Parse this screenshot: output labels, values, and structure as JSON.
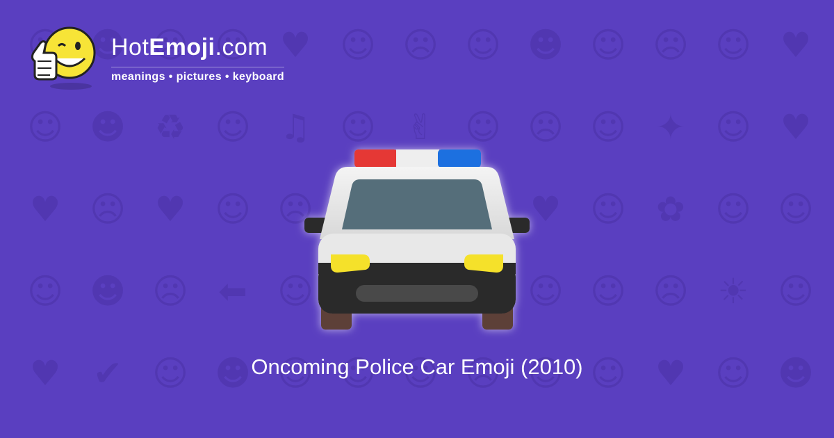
{
  "site": {
    "brand_prefix": "Hot",
    "brand_bold": "Emoji",
    "brand_suffix": ".com",
    "tagline": "meanings • pictures • keyboard",
    "mascot_icon": "winking-thumbs-up-face-icon"
  },
  "emoji": {
    "icon": "oncoming-police-car-icon",
    "caption": "Oncoming Police Car Emoji (2010)"
  },
  "background_icons": [
    "☺",
    "☻",
    "☹",
    "☺",
    "♥",
    "☺",
    "☹",
    "☺",
    "☻",
    "☺",
    "☹",
    "☺",
    "♥",
    "☺",
    "☻",
    "♻",
    "☺",
    "♫",
    "☺",
    "✌",
    "☺",
    "☹",
    "☺",
    "✦",
    "☺",
    "♥",
    "♥",
    "☹",
    "♥",
    "☺",
    "☹",
    "☺",
    "☺",
    "☻",
    "♥",
    "☺",
    "✿",
    "☺",
    "☺",
    "☺",
    "☻",
    "☹",
    "⬅",
    "☺",
    "☺",
    "☻",
    "☺",
    "☺",
    "☺",
    "☹",
    "☀",
    "☺",
    "♥",
    "✔",
    "☺",
    "☻",
    "☺",
    "☺",
    "☺",
    "☹",
    "☺",
    "☺",
    "♥",
    "☺",
    "☻"
  ],
  "colors": {
    "background": "#5a3fc0",
    "pattern": "#4a32a6",
    "siren_red": "#e53935",
    "siren_blue": "#1e6fe0",
    "headlight": "#f5e12a"
  }
}
